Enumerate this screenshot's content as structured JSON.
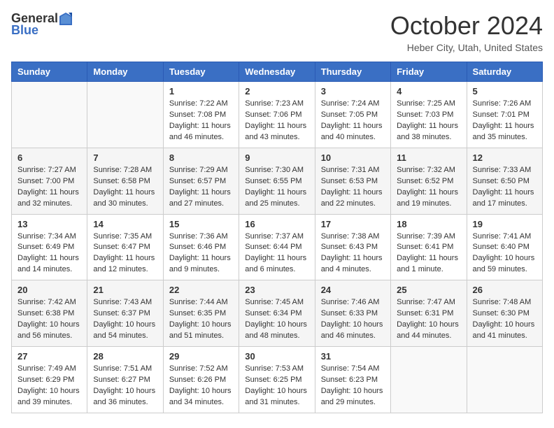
{
  "header": {
    "logo_general": "General",
    "logo_blue": "Blue",
    "title": "October 2024",
    "location": "Heber City, Utah, United States"
  },
  "weekdays": [
    "Sunday",
    "Monday",
    "Tuesday",
    "Wednesday",
    "Thursday",
    "Friday",
    "Saturday"
  ],
  "weeks": [
    [
      {
        "day": "",
        "sunrise": "",
        "sunset": "",
        "daylight": ""
      },
      {
        "day": "",
        "sunrise": "",
        "sunset": "",
        "daylight": ""
      },
      {
        "day": "1",
        "sunrise": "Sunrise: 7:22 AM",
        "sunset": "Sunset: 7:08 PM",
        "daylight": "Daylight: 11 hours and 46 minutes."
      },
      {
        "day": "2",
        "sunrise": "Sunrise: 7:23 AM",
        "sunset": "Sunset: 7:06 PM",
        "daylight": "Daylight: 11 hours and 43 minutes."
      },
      {
        "day": "3",
        "sunrise": "Sunrise: 7:24 AM",
        "sunset": "Sunset: 7:05 PM",
        "daylight": "Daylight: 11 hours and 40 minutes."
      },
      {
        "day": "4",
        "sunrise": "Sunrise: 7:25 AM",
        "sunset": "Sunset: 7:03 PM",
        "daylight": "Daylight: 11 hours and 38 minutes."
      },
      {
        "day": "5",
        "sunrise": "Sunrise: 7:26 AM",
        "sunset": "Sunset: 7:01 PM",
        "daylight": "Daylight: 11 hours and 35 minutes."
      }
    ],
    [
      {
        "day": "6",
        "sunrise": "Sunrise: 7:27 AM",
        "sunset": "Sunset: 7:00 PM",
        "daylight": "Daylight: 11 hours and 32 minutes."
      },
      {
        "day": "7",
        "sunrise": "Sunrise: 7:28 AM",
        "sunset": "Sunset: 6:58 PM",
        "daylight": "Daylight: 11 hours and 30 minutes."
      },
      {
        "day": "8",
        "sunrise": "Sunrise: 7:29 AM",
        "sunset": "Sunset: 6:57 PM",
        "daylight": "Daylight: 11 hours and 27 minutes."
      },
      {
        "day": "9",
        "sunrise": "Sunrise: 7:30 AM",
        "sunset": "Sunset: 6:55 PM",
        "daylight": "Daylight: 11 hours and 25 minutes."
      },
      {
        "day": "10",
        "sunrise": "Sunrise: 7:31 AM",
        "sunset": "Sunset: 6:53 PM",
        "daylight": "Daylight: 11 hours and 22 minutes."
      },
      {
        "day": "11",
        "sunrise": "Sunrise: 7:32 AM",
        "sunset": "Sunset: 6:52 PM",
        "daylight": "Daylight: 11 hours and 19 minutes."
      },
      {
        "day": "12",
        "sunrise": "Sunrise: 7:33 AM",
        "sunset": "Sunset: 6:50 PM",
        "daylight": "Daylight: 11 hours and 17 minutes."
      }
    ],
    [
      {
        "day": "13",
        "sunrise": "Sunrise: 7:34 AM",
        "sunset": "Sunset: 6:49 PM",
        "daylight": "Daylight: 11 hours and 14 minutes."
      },
      {
        "day": "14",
        "sunrise": "Sunrise: 7:35 AM",
        "sunset": "Sunset: 6:47 PM",
        "daylight": "Daylight: 11 hours and 12 minutes."
      },
      {
        "day": "15",
        "sunrise": "Sunrise: 7:36 AM",
        "sunset": "Sunset: 6:46 PM",
        "daylight": "Daylight: 11 hours and 9 minutes."
      },
      {
        "day": "16",
        "sunrise": "Sunrise: 7:37 AM",
        "sunset": "Sunset: 6:44 PM",
        "daylight": "Daylight: 11 hours and 6 minutes."
      },
      {
        "day": "17",
        "sunrise": "Sunrise: 7:38 AM",
        "sunset": "Sunset: 6:43 PM",
        "daylight": "Daylight: 11 hours and 4 minutes."
      },
      {
        "day": "18",
        "sunrise": "Sunrise: 7:39 AM",
        "sunset": "Sunset: 6:41 PM",
        "daylight": "Daylight: 11 hours and 1 minute."
      },
      {
        "day": "19",
        "sunrise": "Sunrise: 7:41 AM",
        "sunset": "Sunset: 6:40 PM",
        "daylight": "Daylight: 10 hours and 59 minutes."
      }
    ],
    [
      {
        "day": "20",
        "sunrise": "Sunrise: 7:42 AM",
        "sunset": "Sunset: 6:38 PM",
        "daylight": "Daylight: 10 hours and 56 minutes."
      },
      {
        "day": "21",
        "sunrise": "Sunrise: 7:43 AM",
        "sunset": "Sunset: 6:37 PM",
        "daylight": "Daylight: 10 hours and 54 minutes."
      },
      {
        "day": "22",
        "sunrise": "Sunrise: 7:44 AM",
        "sunset": "Sunset: 6:35 PM",
        "daylight": "Daylight: 10 hours and 51 minutes."
      },
      {
        "day": "23",
        "sunrise": "Sunrise: 7:45 AM",
        "sunset": "Sunset: 6:34 PM",
        "daylight": "Daylight: 10 hours and 48 minutes."
      },
      {
        "day": "24",
        "sunrise": "Sunrise: 7:46 AM",
        "sunset": "Sunset: 6:33 PM",
        "daylight": "Daylight: 10 hours and 46 minutes."
      },
      {
        "day": "25",
        "sunrise": "Sunrise: 7:47 AM",
        "sunset": "Sunset: 6:31 PM",
        "daylight": "Daylight: 10 hours and 44 minutes."
      },
      {
        "day": "26",
        "sunrise": "Sunrise: 7:48 AM",
        "sunset": "Sunset: 6:30 PM",
        "daylight": "Daylight: 10 hours and 41 minutes."
      }
    ],
    [
      {
        "day": "27",
        "sunrise": "Sunrise: 7:49 AM",
        "sunset": "Sunset: 6:29 PM",
        "daylight": "Daylight: 10 hours and 39 minutes."
      },
      {
        "day": "28",
        "sunrise": "Sunrise: 7:51 AM",
        "sunset": "Sunset: 6:27 PM",
        "daylight": "Daylight: 10 hours and 36 minutes."
      },
      {
        "day": "29",
        "sunrise": "Sunrise: 7:52 AM",
        "sunset": "Sunset: 6:26 PM",
        "daylight": "Daylight: 10 hours and 34 minutes."
      },
      {
        "day": "30",
        "sunrise": "Sunrise: 7:53 AM",
        "sunset": "Sunset: 6:25 PM",
        "daylight": "Daylight: 10 hours and 31 minutes."
      },
      {
        "day": "31",
        "sunrise": "Sunrise: 7:54 AM",
        "sunset": "Sunset: 6:23 PM",
        "daylight": "Daylight: 10 hours and 29 minutes."
      },
      {
        "day": "",
        "sunrise": "",
        "sunset": "",
        "daylight": ""
      },
      {
        "day": "",
        "sunrise": "",
        "sunset": "",
        "daylight": ""
      }
    ]
  ]
}
